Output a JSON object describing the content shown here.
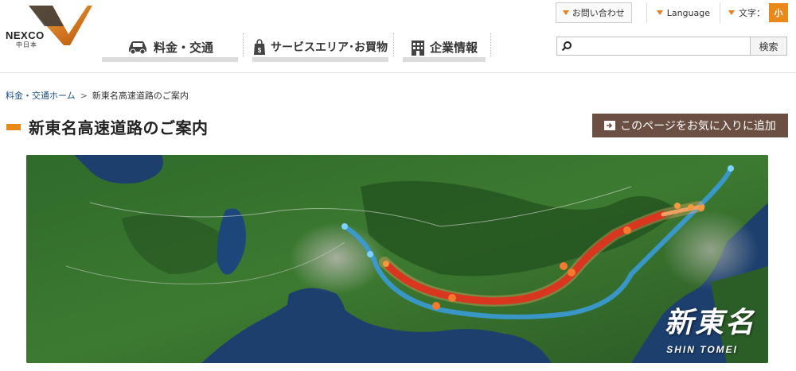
{
  "brand": {
    "name": "NEXCO",
    "sub": "中日本"
  },
  "nav": [
    {
      "label": "料金・交通",
      "icon": "car-icon"
    },
    {
      "label": "サービスエリア･お買物",
      "icon": "shopping-bag-icon"
    },
    {
      "label": "企業情報",
      "icon": "building-icon"
    }
  ],
  "topbar": {
    "inquiry": "お問い合わせ",
    "language": "Language",
    "font_size_label": "文字：",
    "font_size_value": "小"
  },
  "search": {
    "placeholder": "",
    "value": "",
    "button": "検索"
  },
  "breadcrumb": {
    "home": "料金・交通ホーム",
    "separator": ">",
    "current": "新東名高速道路のご案内"
  },
  "page": {
    "title": "新東名高速道路のご案内",
    "favorite_button": "このページをお気に入りに追加"
  },
  "map": {
    "brand_jp": "新東名",
    "brand_en": "SHIN TOMEI"
  },
  "colors": {
    "accent": "#e8891a",
    "favorite_bg": "#6b4f43",
    "route_new": "#d9361f",
    "route_existing": "#3a9bd8"
  }
}
